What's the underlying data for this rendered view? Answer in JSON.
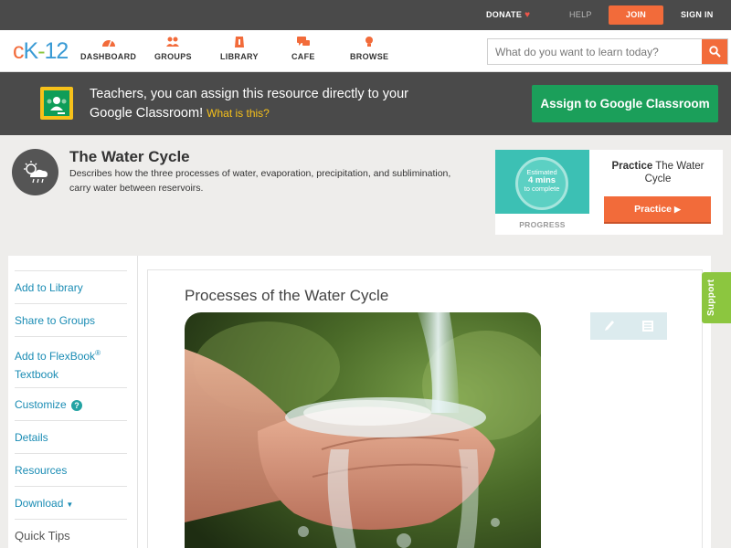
{
  "topbar": {
    "donate": "DONATE",
    "help": "HELP",
    "join": "JOIN",
    "signin": "SIGN IN"
  },
  "logo": {
    "c": "c",
    "k": "K",
    "dash": "-",
    "num": "12"
  },
  "nav": [
    {
      "label": "DASHBOARD",
      "icon": "dashboard-icon"
    },
    {
      "label": "GROUPS",
      "icon": "groups-icon"
    },
    {
      "label": "LIBRARY",
      "icon": "library-icon"
    },
    {
      "label": "CAFE",
      "icon": "cafe-icon"
    },
    {
      "label": "BROWSE",
      "icon": "browse-icon"
    }
  ],
  "search": {
    "placeholder": "What do you want to learn today?"
  },
  "google_banner": {
    "message": "Teachers, you can assign this resource directly to your Google Classroom!",
    "what_link": "What is this?",
    "button": "Assign to Google Classroom"
  },
  "concept": {
    "title": "The Water Cycle",
    "description": "Describes how the three processes of water, evaporation, precipitation, and sublimination, carry water between reservoirs."
  },
  "practice": {
    "estimated": "Estimated",
    "mins": "4 mins",
    "to_complete": "to complete",
    "progress_label": "PROGRESS",
    "title_bold": "Practice",
    "title_rest": "The Water Cycle",
    "button": "Practice"
  },
  "sidebar": {
    "items": [
      {
        "label": "Add to Library"
      },
      {
        "label": "Share to Groups"
      },
      {
        "label_line1": "Add to FlexBook",
        "sup": "®",
        "label_line2": "Textbook"
      },
      {
        "label": "Customize",
        "badge": "?"
      },
      {
        "label": "Details"
      },
      {
        "label": "Resources"
      },
      {
        "label": "Download",
        "caret": "▼"
      },
      {
        "label": "Quick Tips"
      }
    ]
  },
  "content": {
    "section_title": "Processes of the Water Cycle"
  },
  "support": "Support",
  "colors": {
    "brand_orange": "#f26b3a",
    "google_green": "#1b9f5a",
    "link_blue": "#1a8cb4",
    "support_green": "#8cc63f",
    "teal": "#3cc0b4"
  }
}
